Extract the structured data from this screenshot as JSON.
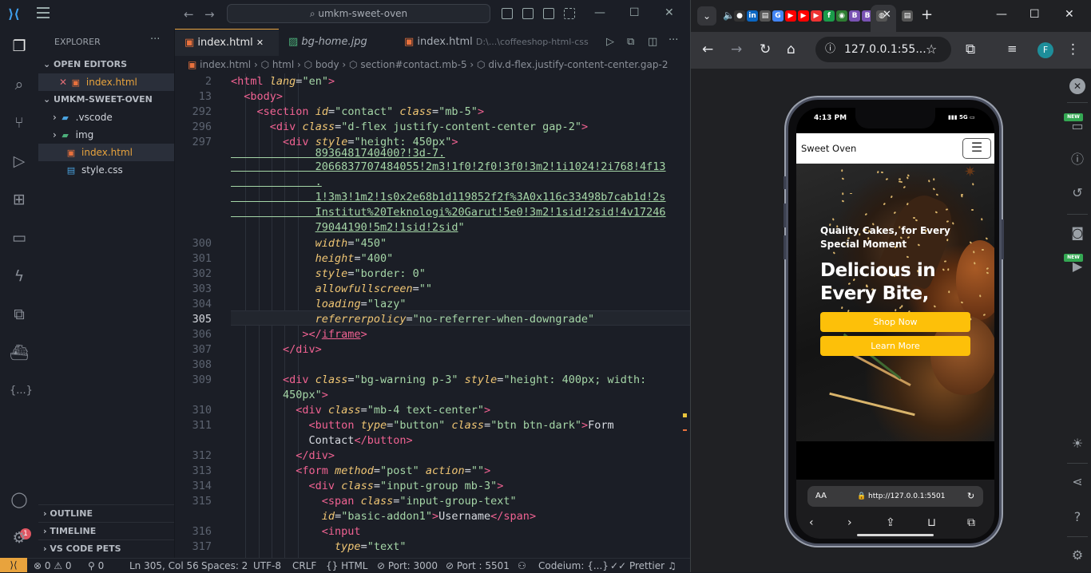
{
  "vscode": {
    "search": "umkm-sweet-oven",
    "explorer_title": "EXPLORER",
    "open_editors": "OPEN EDITORS",
    "open_file": "index.html",
    "project": "UMKM-SWEET-OVEN",
    "tree": [
      ".vscode",
      "img",
      "index.html",
      "style.css"
    ],
    "outline": "OUTLINE",
    "timeline": "TIMELINE",
    "pets": "VS CODE PETS",
    "badge": "1",
    "tabs": {
      "t1": "index.html",
      "t2": "bg-home.jpg",
      "t3": "index.html",
      "t3_path": "D:\\...\\coffeeshop-html-css"
    },
    "breadcrumb": [
      "index.html",
      "html",
      "body",
      "section#contact.mb-5",
      "div.d-flex.justify-content-center.gap-2"
    ],
    "line_numbers": [
      "2",
      "13",
      "292",
      "296",
      "297",
      "",
      "",
      "",
      "",
      "",
      "300",
      "301",
      "302",
      "303",
      "304",
      "305",
      "306",
      "307",
      "308",
      "309",
      "",
      "310",
      "311",
      "",
      "312",
      "313",
      "314",
      "315",
      "",
      "316",
      "317"
    ],
    "status": {
      "errors": "0",
      "warnings": "0",
      "ports": "0",
      "position": "Ln 305, Col 56",
      "spaces": "Spaces: 2",
      "encoding": "UTF-8",
      "eol": "CRLF",
      "lang": "HTML",
      "port": "Port: 3000",
      "port2": "Port : 5501",
      "codeium": "Codeium: {...}",
      "prettier": "Prettier"
    }
  },
  "browser": {
    "url": "127.0.0.1:55...",
    "avatar": "F",
    "new_label": "NEW"
  },
  "phone": {
    "time": "4:13 PM",
    "signal": "5G",
    "brand": "Sweet Oven",
    "hero_sub": "Quality Cakes, for Every Special Moment",
    "hero_title": "Delicious in Every Bite,",
    "btn_shop": "Shop Now",
    "btn_learn": "Learn More",
    "aa": "AA",
    "url": "http://127.0.0.1:5501"
  },
  "colors": {
    "accent": "#e8a33d",
    "yellow": "#fdc009",
    "tag": "#f06292",
    "attr": "#f0c674",
    "string": "#a5d6a7"
  }
}
